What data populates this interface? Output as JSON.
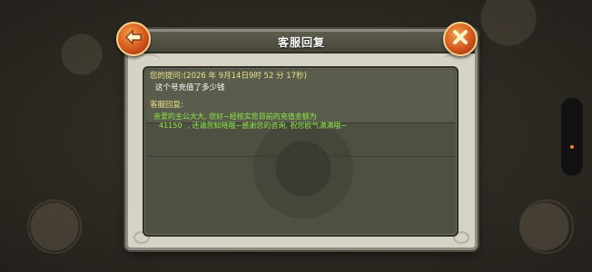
{
  "dialog": {
    "title": "客服回复"
  },
  "question": {
    "label": "您的提问:(2026 年 9月14日9时 52 分 17秒)",
    "text": "这个号充值了多少钱"
  },
  "reply": {
    "label": "客服回复:",
    "line1": "亲爱的主公大大,   您好~经核实您目前的充值金额为",
    "amount": "41150",
    "line2": ",   还请您知晓哦~感谢您的咨询,   祝您欧气满满哦~"
  },
  "icons": {
    "back": "arrow-left-icon",
    "close": "close-x-icon"
  },
  "colors": {
    "label": "#e8e08a",
    "reply_text": "#8ee84a",
    "button": "#d4561d"
  }
}
